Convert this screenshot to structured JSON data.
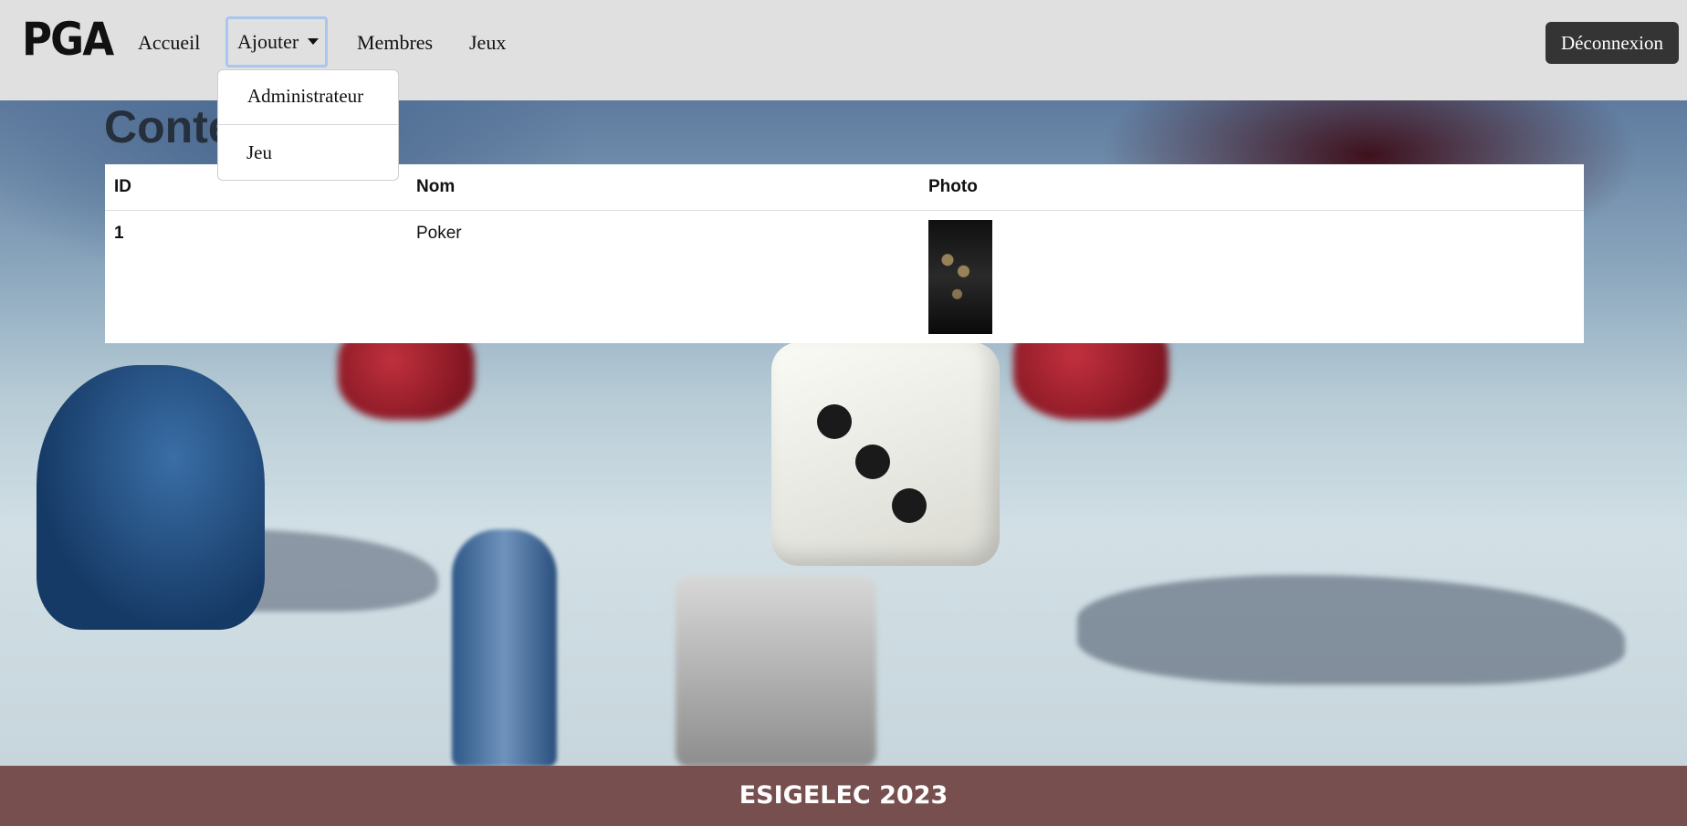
{
  "navbar": {
    "brand": "PGA",
    "items": [
      {
        "label": "Accueil"
      },
      {
        "label": "Ajouter"
      },
      {
        "label": "Membres"
      },
      {
        "label": "Jeux"
      }
    ],
    "logout_label": "Déconnexion"
  },
  "dropdown": {
    "items": [
      {
        "label": "Administrateur"
      },
      {
        "label": "Jeu"
      }
    ]
  },
  "main": {
    "title": "Conte",
    "table": {
      "headers": [
        "ID",
        "Nom",
        "Photo"
      ],
      "rows": [
        {
          "id": "1",
          "nom": "Poker"
        }
      ]
    }
  },
  "footer": {
    "text": "ESIGELEC 2023"
  },
  "colors": {
    "navbar_bg": "#e0e0e0",
    "logout_bg": "#343434",
    "footer_bg": "#774f4f",
    "active_outline": "#a9c6ec"
  }
}
